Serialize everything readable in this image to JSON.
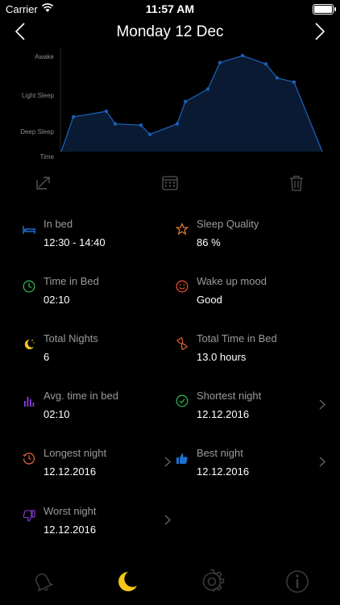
{
  "status_bar": {
    "carrier": "Carrier",
    "time": "11:57 AM"
  },
  "nav": {
    "title": "Monday 12 Dec",
    "prev_icon": "chevron-left-icon",
    "next_icon": "chevron-right-icon"
  },
  "chart_data": {
    "type": "area",
    "y_categories": [
      "Deep Sleep",
      "Light Sleep",
      "Awake"
    ],
    "y_axis_labels": {
      "awake": "Awake",
      "light": "Light Sleep",
      "deep": "Deep Sleep",
      "time": "Time"
    },
    "ylim": [
      0,
      3
    ],
    "values": [
      0,
      1.25,
      1.45,
      1.0,
      0.95,
      0.62,
      1.0,
      1.8,
      2.25,
      3.2,
      3.45,
      3.15,
      2.65,
      2.5,
      0
    ],
    "line_color": "#1a5fb4",
    "fill_color": "#0a1a33",
    "grid": false
  },
  "toolbar": {
    "share_icon": "share-icon",
    "calendar_icon": "calendar-icon",
    "trash_icon": "trash-icon"
  },
  "stats": {
    "in_bed": {
      "label": "In bed",
      "value": "12:30 - 14:40",
      "icon": "bed-icon",
      "color": "#1f6fd0"
    },
    "sleep_quality": {
      "label": "Sleep Quality",
      "value": "86 %",
      "icon": "star-icon",
      "color": "#e8822a"
    },
    "time_in_bed": {
      "label": "Time in Bed",
      "value": "02:10",
      "icon": "clock-icon",
      "color": "#2fae4e"
    },
    "wake_mood": {
      "label": "Wake up mood",
      "value": "Good",
      "icon": "smiley-icon",
      "color": "#e04a2a"
    },
    "total_nights": {
      "label": "Total Nights",
      "value": "6",
      "icon": "moon-stars-icon",
      "color": "#f5c518"
    },
    "total_time": {
      "label": "Total Time in Bed",
      "value": "13.0 hours",
      "icon": "hourglass-icon",
      "color": "#e0623a"
    },
    "avg_time": {
      "label": "Avg. time in bed",
      "value": "02:10",
      "icon": "bar-chart-icon",
      "color": "#8a3ee0"
    },
    "shortest": {
      "label": "Shortest night",
      "value": "12.12.2016",
      "icon": "check-clock-icon",
      "color": "#2fae4e"
    },
    "longest": {
      "label": "Longest night",
      "value": "12.12.2016",
      "icon": "history-clock-icon",
      "color": "#e0623a"
    },
    "best": {
      "label": "Best night",
      "value": "12.12.2016",
      "icon": "thumbs-up-icon",
      "color": "#1f6fd0"
    },
    "worst": {
      "label": "Worst night",
      "value": "12.12.2016",
      "icon": "thumbs-down-icon",
      "color": "#8a3ee0"
    }
  },
  "tabbar": {
    "alarm_icon": "bell-icon",
    "sleep_icon": "moon-icon",
    "settings_icon": "gear-icon",
    "info_icon": "info-icon",
    "active_color": "#f5c518",
    "inactive_color": "#3a3a3a"
  }
}
